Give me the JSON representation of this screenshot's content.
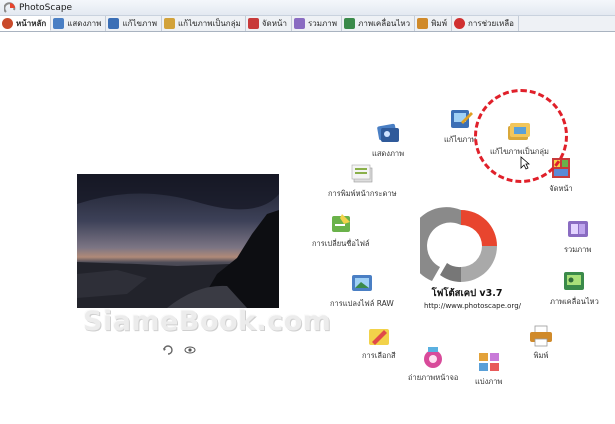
{
  "window": {
    "title": "PhotoScape"
  },
  "tabs": [
    {
      "label": "หน้าหลัก",
      "icon": "home-icon",
      "color": "#c94a2a"
    },
    {
      "label": "แสดงภาพ",
      "icon": "viewer-icon",
      "color": "#4a7fc4"
    },
    {
      "label": "แก้ไขภาพ",
      "icon": "editor-icon",
      "color": "#3b6fb6"
    },
    {
      "label": "แก้ไขภาพเป็นกลุ่ม",
      "icon": "batch-editor-icon",
      "color": "#d2a23a"
    },
    {
      "label": "จัดหน้า",
      "icon": "page-icon",
      "color": "#c83a3a"
    },
    {
      "label": "รวมภาพ",
      "icon": "combine-icon",
      "color": "#8a6cc2"
    },
    {
      "label": "ภาพเคลื่อนไหว",
      "icon": "animated-gif-icon",
      "color": "#3a8a4a"
    },
    {
      "label": "พิมพ์",
      "icon": "print-icon",
      "color": "#d08a2a"
    },
    {
      "label": "การช่วยเหลือ",
      "icon": "help-icon",
      "color": "#d03030"
    }
  ],
  "menu": {
    "viewer": "แสดงภาพ",
    "editor": "แก้ไขภาพ",
    "batch_editor": "แก้ไขภาพเป็นกลุ่ม",
    "page": "จัดหน้า",
    "combine": "รวมภาพ",
    "animated_gif": "ภาพเคลื่อนไหว",
    "print": "พิมพ์",
    "splitter": "แบ่งภาพ",
    "screen_capture": "ถ่ายภาพหน้าจอ",
    "color_picker": "การเลือกสี",
    "raw_converter": "การแปลงไฟล์ RAW",
    "rename": "การเปลี่ยนชื่อไฟล์",
    "paper_print": "การพิมพ์หน้ากระดาษ"
  },
  "brand": {
    "name": "โฟโต้สเคป v3.7",
    "url": "http://www.photoscape.org/"
  },
  "watermark": "SiameBook.com",
  "colors": {
    "logo_red": "#e8452e",
    "logo_gray": "#8a8a8a",
    "highlight": "#e0202a"
  }
}
